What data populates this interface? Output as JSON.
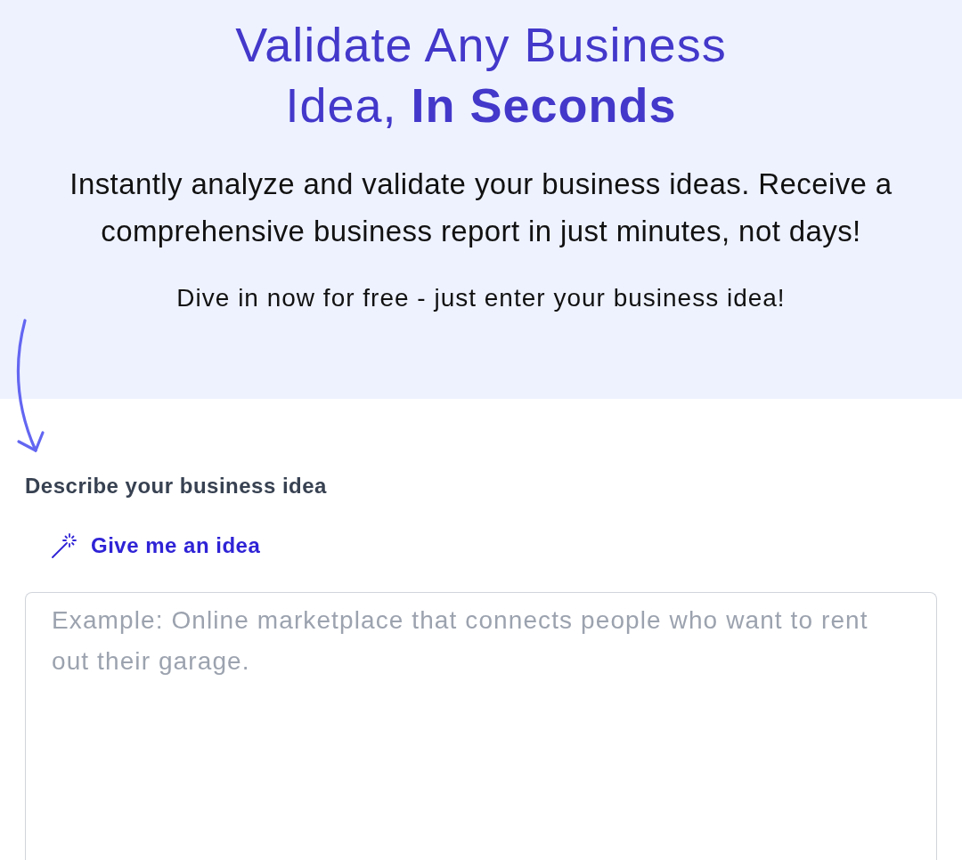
{
  "hero": {
    "title": "Validate Any Business Idea, **In Seconds**",
    "subtitle": "Instantly analyze and validate your business ideas. Receive a comprehensive business report in just minutes, not days!",
    "cta_text": "Dive in now for free - just enter your business idea!"
  },
  "form": {
    "label": "Describe your business idea",
    "idea_link": "Give me an idea",
    "textarea": {
      "placeholder": "Example: Online marketplace that connects people who want to rent out their garage."
    }
  }
}
